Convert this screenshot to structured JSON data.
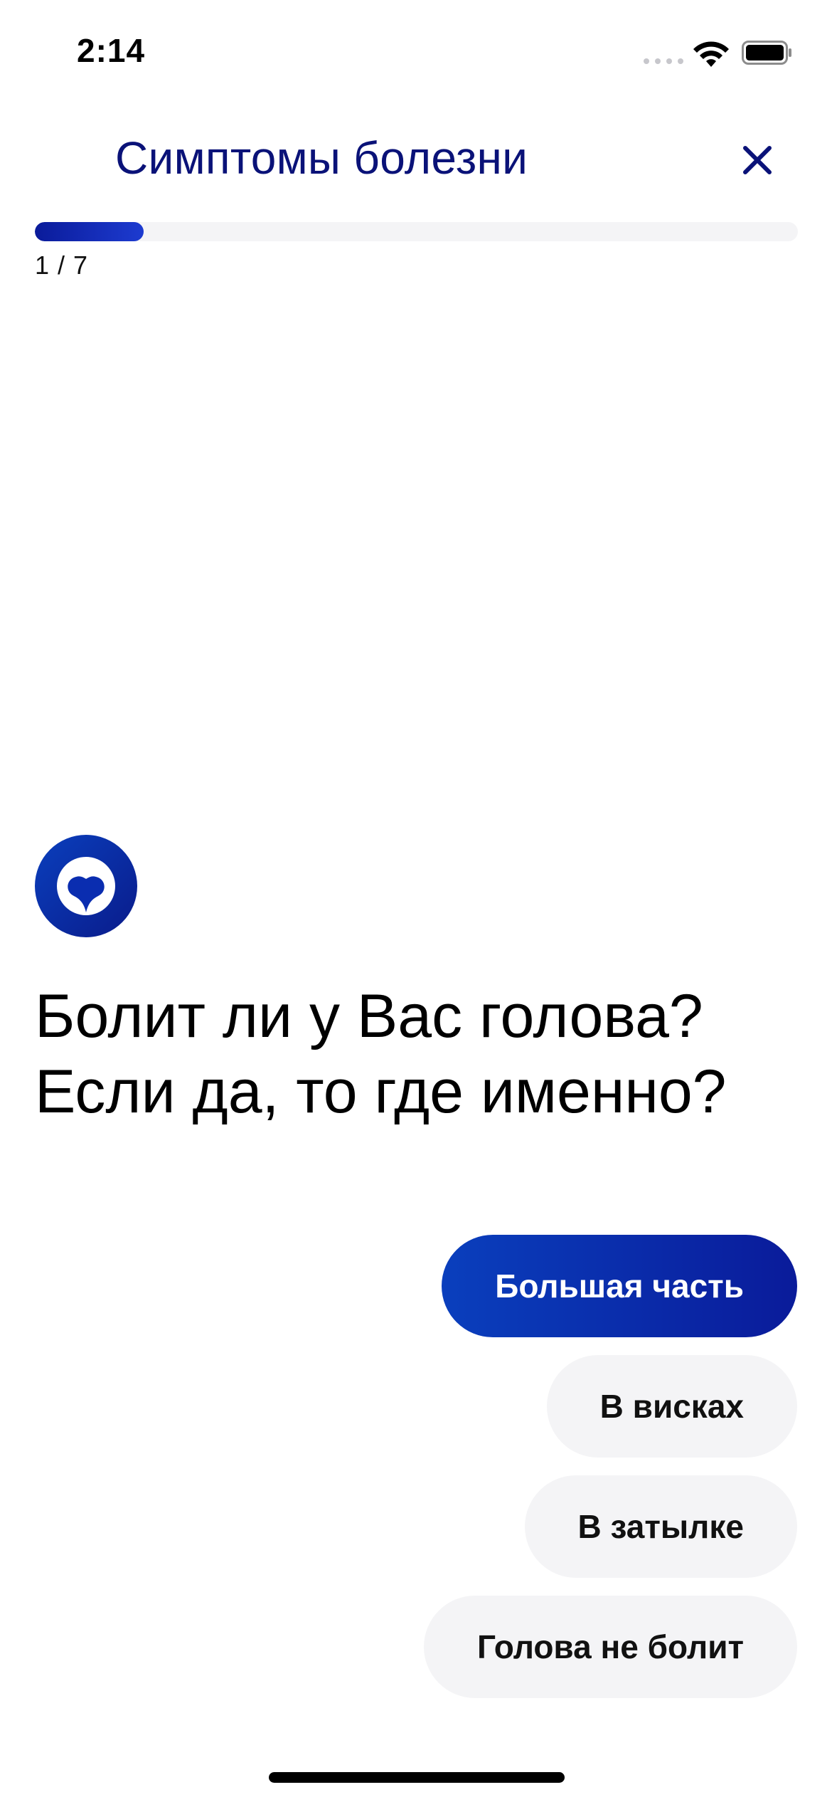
{
  "status_bar": {
    "time": "2:14"
  },
  "header": {
    "title": "Симптомы болезни",
    "close_icon": "close-icon"
  },
  "progress": {
    "current": 1,
    "total": 7,
    "label": "1 / 7",
    "fraction": 0.143
  },
  "question": {
    "line1": "Болит ли у Вас голова?",
    "line2": "Если да, то где именно?"
  },
  "answers": [
    {
      "label": "Большая часть",
      "selected": true
    },
    {
      "label": "В висках",
      "selected": false
    },
    {
      "label": "В затылке",
      "selected": false
    },
    {
      "label": "Голова не болит",
      "selected": false
    }
  ],
  "colors": {
    "brand_dark": "#0a1278",
    "brand_blue": "#0a2db0",
    "chip_bg": "#f4f4f6"
  }
}
